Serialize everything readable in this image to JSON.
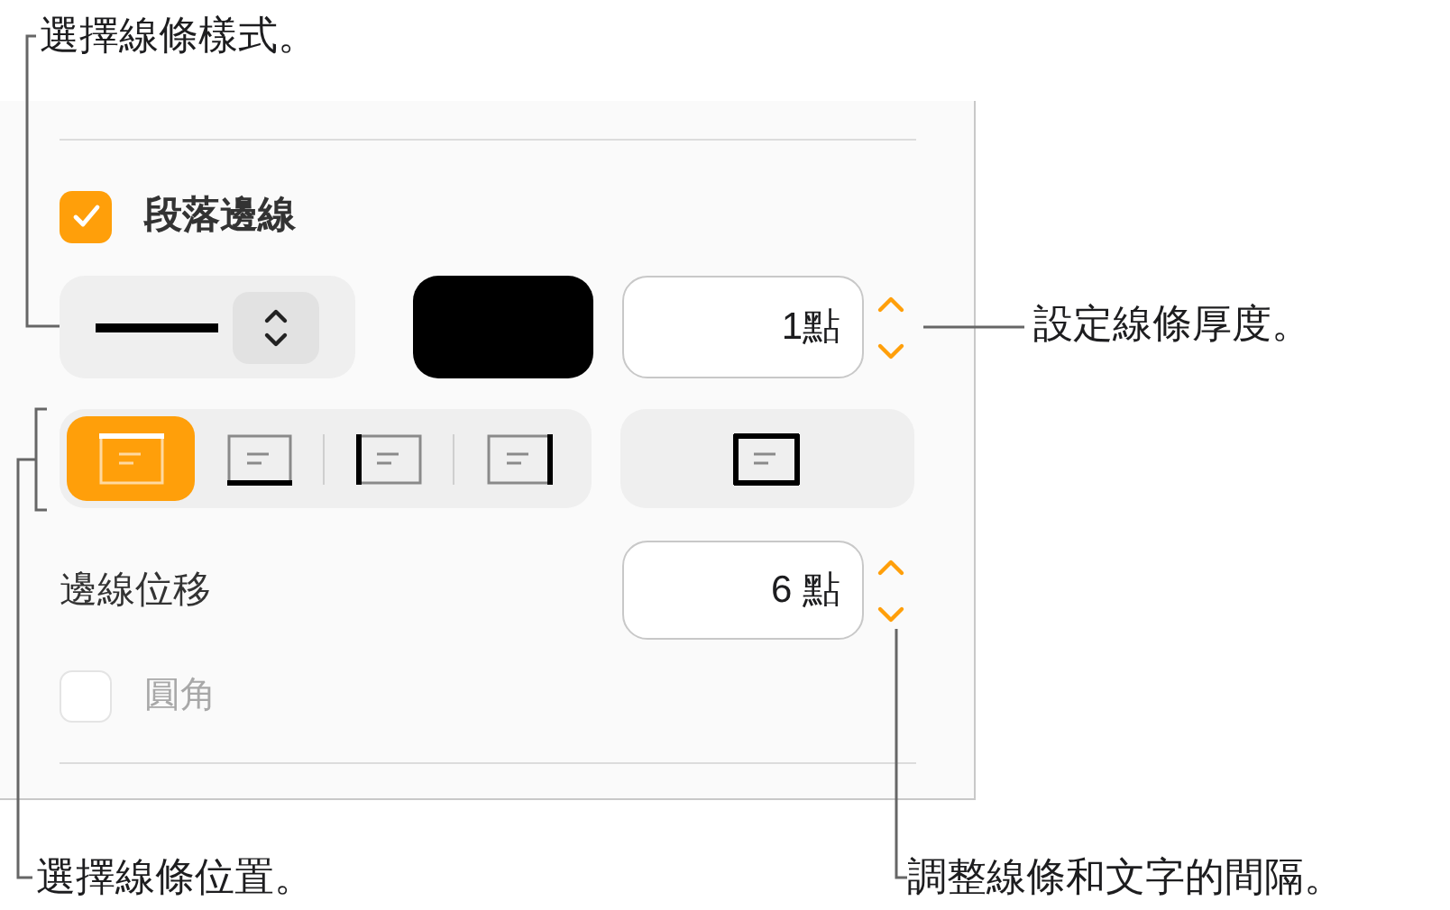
{
  "callouts": [
    {
      "text": "選擇線條樣式。"
    },
    {
      "text": "設定線條厚度。"
    },
    {
      "text": "選擇線條位置。"
    },
    {
      "text": "調整線條和文字的間隔。"
    }
  ],
  "panel": {
    "border_checkbox": {
      "label": "段落邊線",
      "checked": true
    },
    "line_style": {
      "kind": "solid"
    },
    "color": "#000000",
    "thickness": {
      "value": "1點"
    },
    "positions": [
      {
        "kind": "top",
        "selected": true
      },
      {
        "kind": "bottom",
        "selected": false
      },
      {
        "kind": "left",
        "selected": false
      },
      {
        "kind": "right",
        "selected": false
      }
    ],
    "box_position": {
      "kind": "box",
      "selected": false
    },
    "offset": {
      "label": "邊線位移",
      "value": "6 點"
    },
    "rounded": {
      "label": "圓角",
      "checked": false,
      "disabled": true
    }
  }
}
